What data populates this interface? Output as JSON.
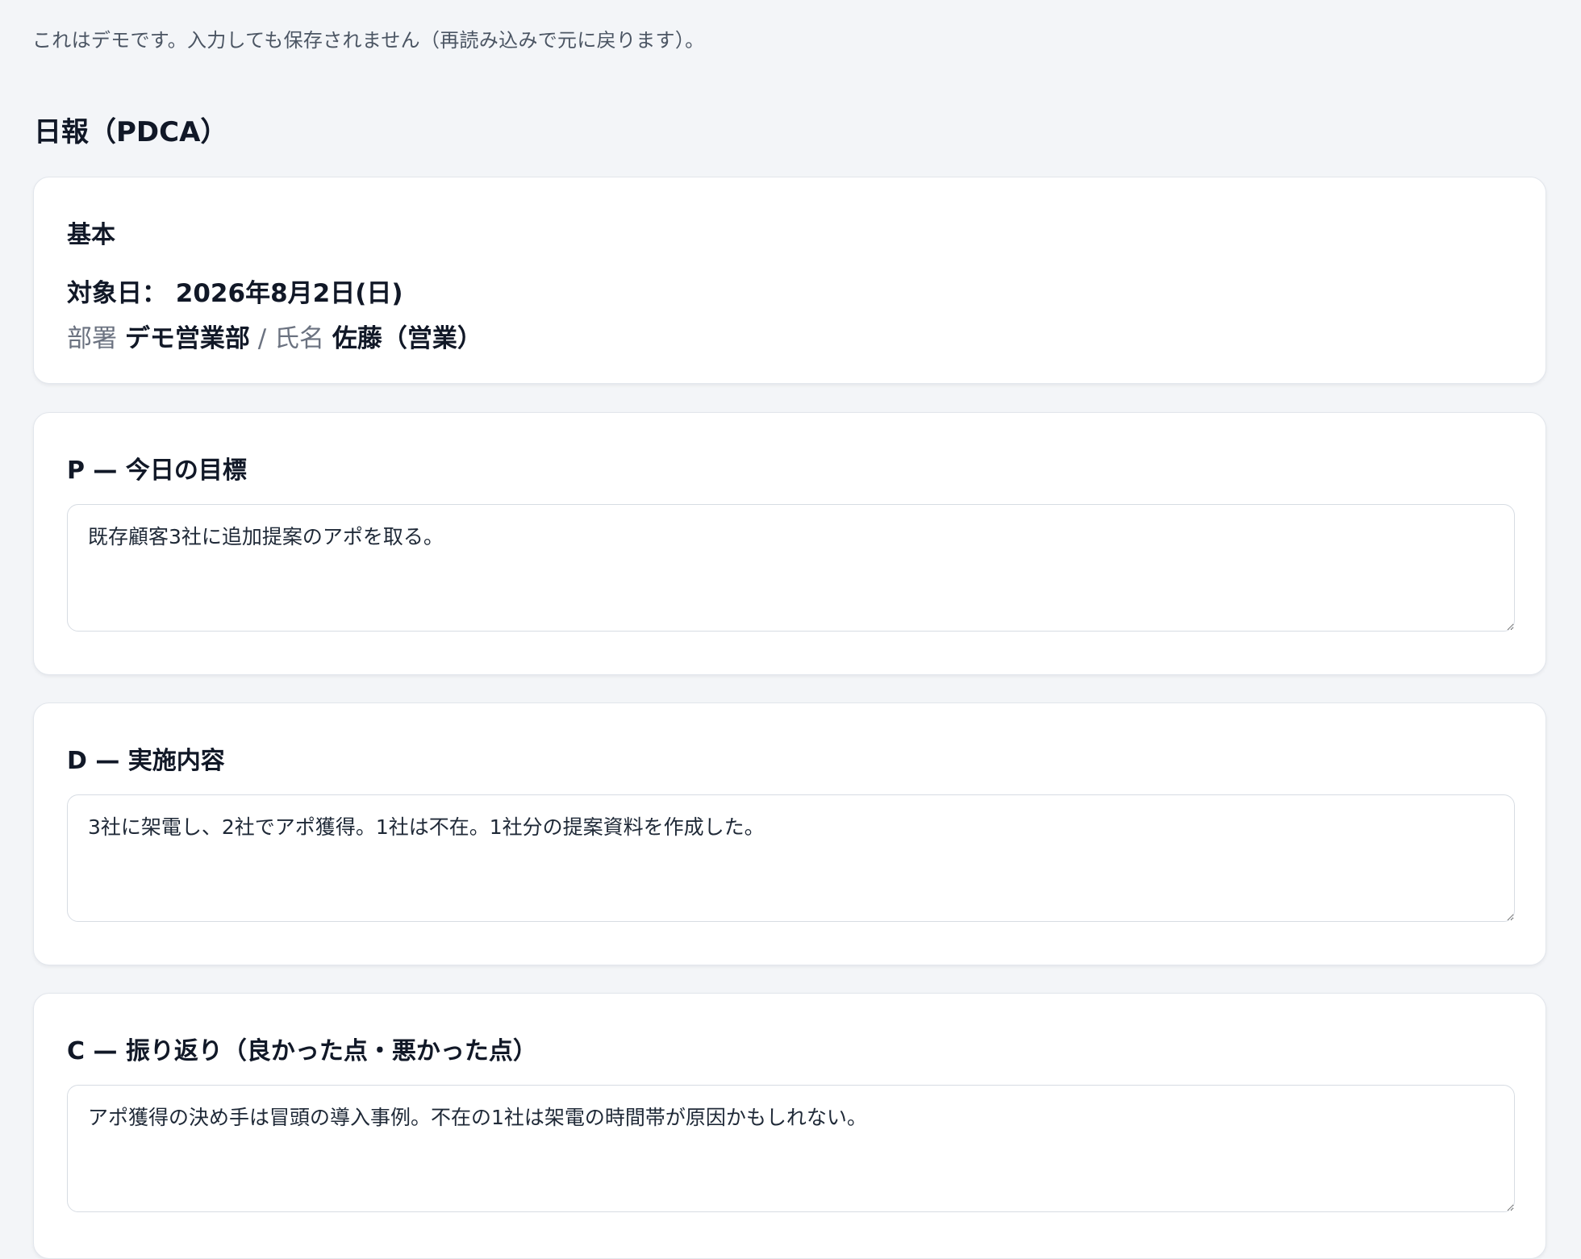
{
  "notice": "これはデモです。入力しても保存されません（再読み込みで元に戻ります）。",
  "page_title": "日報（PDCA）",
  "basic": {
    "title": "基本",
    "date_label": "対象日：",
    "date_value": "2026年8月2日(日)",
    "dept_label": "部署",
    "dept_value": "デモ営業部",
    "separator": "/",
    "name_label": "氏名",
    "name_value": "佐藤（営業）"
  },
  "sections": {
    "p": {
      "title": "P — 今日の目標",
      "value": "既存顧客3社に追加提案のアポを取る。"
    },
    "d": {
      "title": "D — 実施内容",
      "value": "3社に架電し、2社でアポ獲得。1社は不在。1社分の提案資料を作成した。"
    },
    "c": {
      "title": "C — 振り返り（良かった点・悪かった点）",
      "value": "アポ獲得の決め手は冒頭の導入事例。不在の1社は架電の時間帯が原因かもしれない。"
    }
  },
  "icons": {
    "resize": "resize-grip-icon"
  }
}
